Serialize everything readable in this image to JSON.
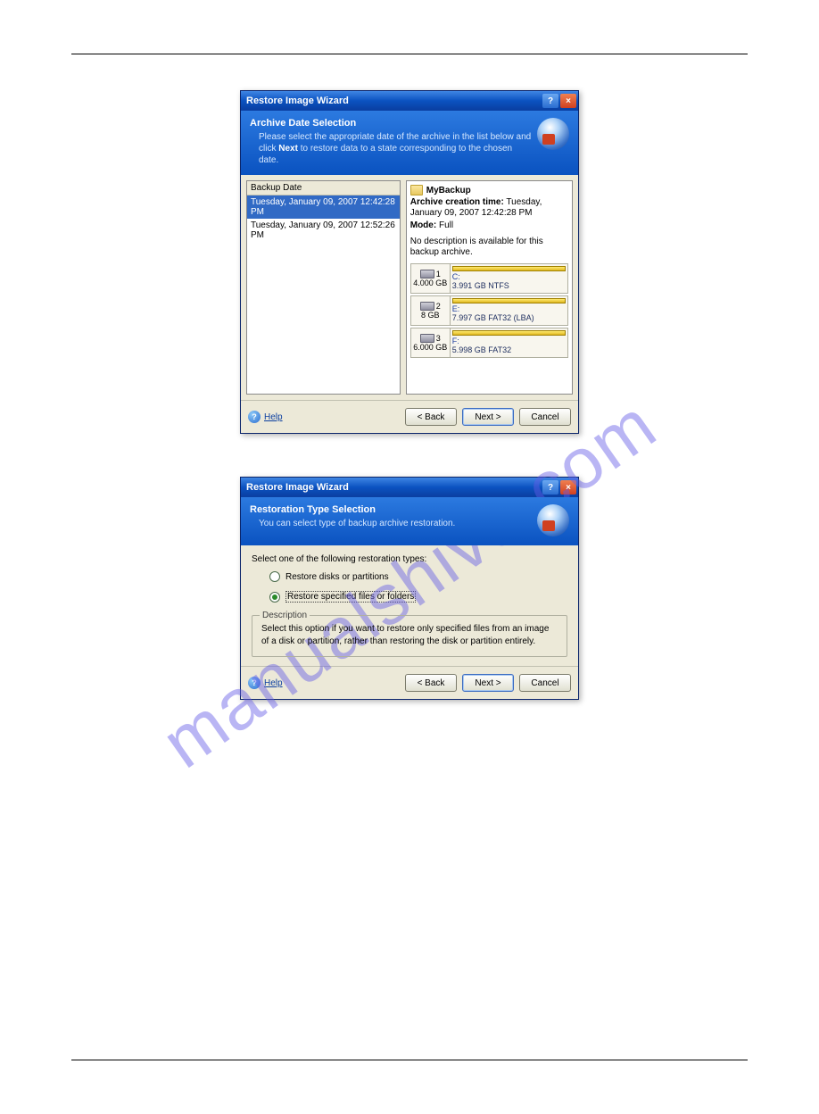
{
  "watermark": "manualshive.com",
  "dialog1": {
    "title": "Restore Image Wizard",
    "banner_title": "Archive Date Selection",
    "banner_sub_before": "Please select the appropriate date of the archive in the list below and click ",
    "banner_sub_bold": "Next",
    "banner_sub_after": " to restore data to a state corresponding to the chosen date.",
    "list_header": "Backup Date",
    "list_rows": [
      "Tuesday, January 09, 2007 12:42:28 PM",
      "Tuesday, January 09, 2007 12:52:26 PM"
    ],
    "archive_name": "MyBackup",
    "creation_label": "Archive creation time:",
    "creation_value": "Tuesday, January 09, 2007 12:42:28 PM",
    "mode_label": "Mode:",
    "mode_value": "Full",
    "no_desc": "No description is available for this backup archive.",
    "disks": [
      {
        "num": "1",
        "total": "4.000 GB",
        "letter": "C:",
        "part": "3.991 GB  NTFS"
      },
      {
        "num": "2",
        "total": "8 GB",
        "letter": "E:",
        "part": "7.997 GB  FAT32 (LBA)"
      },
      {
        "num": "3",
        "total": "6.000 GB",
        "letter": "F:",
        "part": "5.998 GB  FAT32"
      }
    ]
  },
  "dialog2": {
    "title": "Restore Image Wizard",
    "banner_title": "Restoration Type Selection",
    "banner_sub": "You can select type of backup archive restoration.",
    "instruction": "Select one of the following restoration types:",
    "radio1": "Restore disks or partitions",
    "radio2": "Restore specified files or folders",
    "desc_legend": "Description",
    "desc_text": "Select this option if you want to restore only specified files from an image of a disk or partition, rather than restoring the disk or partition entirely."
  },
  "buttons": {
    "help": "Help",
    "back": "< Back",
    "next": "Next >",
    "cancel": "Cancel"
  }
}
